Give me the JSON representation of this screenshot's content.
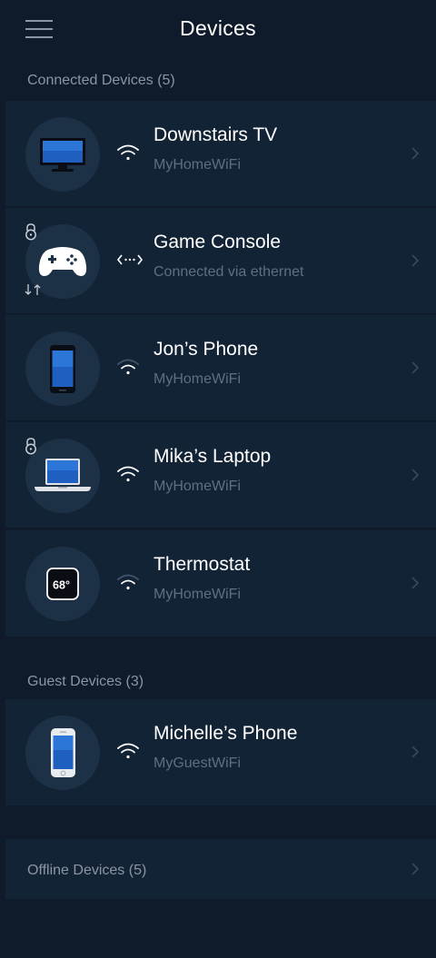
{
  "header": {
    "title": "Devices",
    "menu_icon": "hamburger-menu-icon"
  },
  "sections": {
    "connected_label": "Connected Devices (5)",
    "guest_label": "Guest Devices  (3)",
    "offline_label": "Offline Devices  (5)"
  },
  "connected_devices": [
    {
      "name": "Downstairs TV",
      "subtitle": "MyHomeWiFi",
      "icon": "tv-icon",
      "connection": "wifi-icon",
      "locked": false
    },
    {
      "name": "Game Console",
      "subtitle": "Connected via ethernet",
      "icon": "gamepad-icon",
      "connection": "ethernet-icon",
      "locked": true,
      "traffic_indicator": "↓↑"
    },
    {
      "name": "Jon’s Phone",
      "subtitle": "MyHomeWiFi",
      "icon": "phone-icon",
      "connection": "wifi-icon",
      "locked": false
    },
    {
      "name": "Mika’s Laptop",
      "subtitle": "MyHomeWiFi",
      "icon": "laptop-icon",
      "connection": "wifi-icon",
      "locked": true
    },
    {
      "name": "Thermostat",
      "subtitle": "MyHomeWiFi",
      "icon": "thermostat-icon",
      "connection": "wifi-icon",
      "locked": false,
      "thermostat_reading": "68°"
    }
  ],
  "guest_devices": [
    {
      "name": "Michelle’s Phone",
      "subtitle": "MyGuestWiFi",
      "icon": "iphone-icon",
      "connection": "wifi-icon",
      "locked": false
    }
  ],
  "colors": {
    "background": "#0f1b2a",
    "row": "#132336",
    "avatar": "#1c3046",
    "muted_text": "#8b95a3",
    "subtitle_text": "#5f6e81"
  }
}
